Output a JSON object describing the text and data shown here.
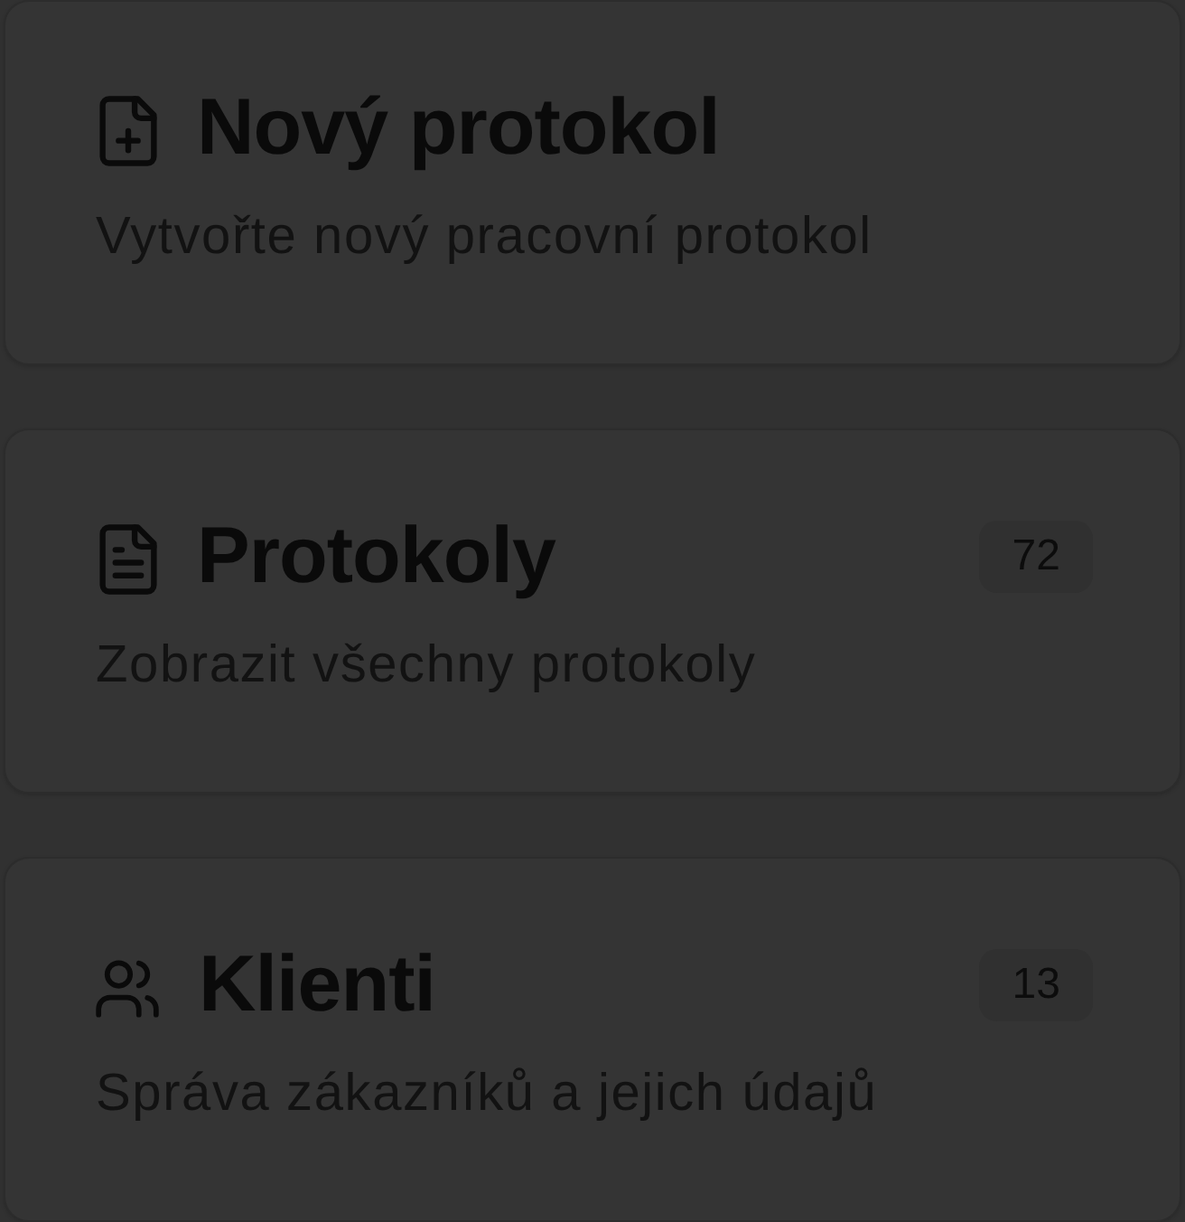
{
  "cards": [
    {
      "title": "Nový protokol",
      "description": "Vytvořte nový pracovní protokol"
    },
    {
      "title": "Protokoly",
      "description": "Zobrazit všechny protokoly",
      "count": "72"
    },
    {
      "title": "Klienti",
      "description": "Správa zákazníků a jejich údajů",
      "count": "13"
    }
  ]
}
